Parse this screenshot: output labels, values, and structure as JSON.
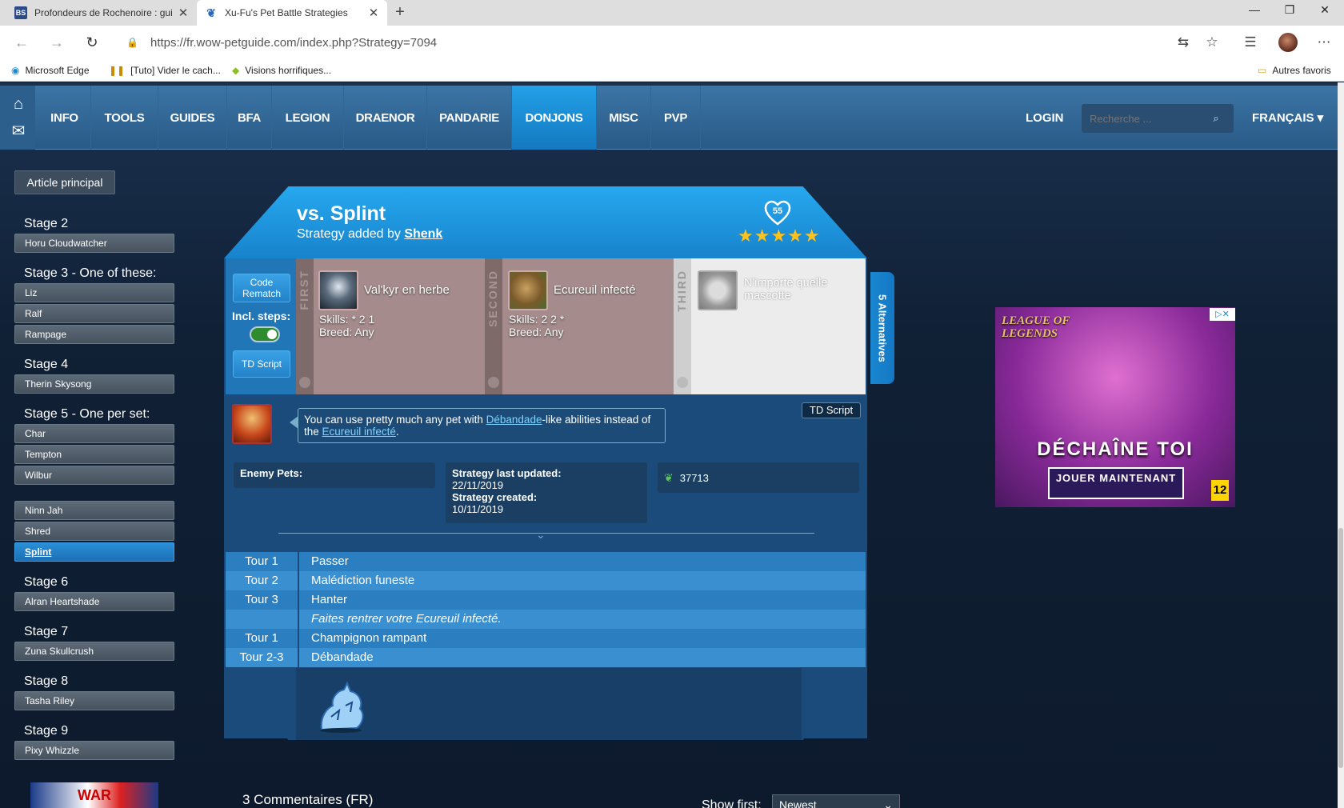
{
  "browser": {
    "tabs": [
      {
        "title": "Profondeurs de Rochenoire : gui",
        "favicon": "BS"
      },
      {
        "title": "Xu-Fu's Pet Battle Strategies",
        "favicon": "paw"
      }
    ],
    "url": "https://fr.wow-petguide.com/index.php?Strategy=7094",
    "bookmarks": [
      "Microsoft Edge",
      "[Tuto] Vider le cach...",
      "Visions horrifiques..."
    ],
    "other_favorites": "Autres favoris"
  },
  "site": {
    "nav": [
      "INFO",
      "TOOLS",
      "GUIDES",
      "BFA",
      "LEGION",
      "DRAENOR",
      "PANDARIE",
      "DONJONS",
      "MISC",
      "PVP"
    ],
    "active_nav": "DONJONS",
    "login": "LOGIN",
    "search_placeholder": "Recherche ...",
    "language": "FRANÇAIS ▾",
    "accent": "#1a8ad4"
  },
  "sidebar": {
    "main_article": "Article principal",
    "stage2": {
      "title": "Stage 2",
      "items": [
        "Horu Cloudwatcher"
      ]
    },
    "stage3": {
      "title": "Stage 3 - One of these:",
      "items": [
        "Liz",
        "Ralf",
        "Rampage"
      ]
    },
    "stage4": {
      "title": "Stage 4",
      "items": [
        "Therin Skysong"
      ]
    },
    "stage5": {
      "title": "Stage 5 - One per set:",
      "items": [
        "Char",
        "Tempton",
        "Wilbur"
      ]
    },
    "stage5b": {
      "items": [
        "Ninn Jah",
        "Shred",
        "Splint"
      ]
    },
    "stage6": {
      "title": "Stage 6",
      "items": [
        "Alran Heartshade"
      ]
    },
    "stage7": {
      "title": "Stage 7",
      "items": [
        "Zuna Skullcrush"
      ]
    },
    "stage8": {
      "title": "Stage 8",
      "items": [
        "Tasha Riley"
      ]
    },
    "stage9": {
      "title": "Stage 9",
      "items": [
        "Pixy Whizzle"
      ]
    },
    "active": "Splint",
    "ad_text": "WAR"
  },
  "strategy": {
    "title": "vs. Splint",
    "added_by_prefix": "Strategy added by ",
    "author": "Shenk",
    "likes": "55",
    "stars": "★★★★★",
    "code_rematch": "Code Rematch",
    "incl_steps": "Incl. steps:",
    "incl_steps_on": true,
    "td_script_button": "TD Script",
    "slots": [
      {
        "label": "FIRST",
        "pet": "Val'kyr en herbe",
        "skills": "Skills: * 2 1",
        "breed": "Breed: Any"
      },
      {
        "label": "SECOND",
        "pet": "Ecureuil infecté",
        "skills": "Skills: 2 2 *",
        "breed": "Breed: Any"
      },
      {
        "label": "THIRD",
        "pet": "N'importe quelle mascotte"
      }
    ],
    "alternatives": "5 Alternatives",
    "td_script_tag": "TD Script",
    "tip_prefix": "You can use pretty much any pet with ",
    "tip_link1": "Débandade",
    "tip_middle": "-like abilities instead of the ",
    "tip_link2": "Ecureuil infecté",
    "tip_suffix": ".",
    "enemy_pets": "Enemy Pets:",
    "last_updated_label": "Strategy last updated:",
    "last_updated": "22/11/2019",
    "created_label": "Strategy created:",
    "created": "10/11/2019",
    "views": "37713",
    "turns": [
      {
        "turn": "Tour 1",
        "action": "Passer",
        "italic": false
      },
      {
        "turn": "Tour 2",
        "action": "Malédiction funeste",
        "italic": false
      },
      {
        "turn": "Tour 3",
        "action": "Hanter",
        "italic": false
      },
      {
        "turn": "",
        "action": "Faites rentrer votre Ecureuil infecté.",
        "italic": true
      },
      {
        "turn": "Tour 1",
        "action": "Champignon rampant",
        "italic": false
      },
      {
        "turn": "Tour 2-3",
        "action": "Débandade",
        "italic": false
      }
    ]
  },
  "ad": {
    "brand": "LEAGUE OF LEGENDS",
    "headline": "DÉCHAÎNE TOI",
    "cta": "JOUER MAINTENANT",
    "age": "12"
  },
  "comments": {
    "title": "3 Commentaires (FR)",
    "show_first_label": "Show first:",
    "sort_value": "Newest"
  }
}
